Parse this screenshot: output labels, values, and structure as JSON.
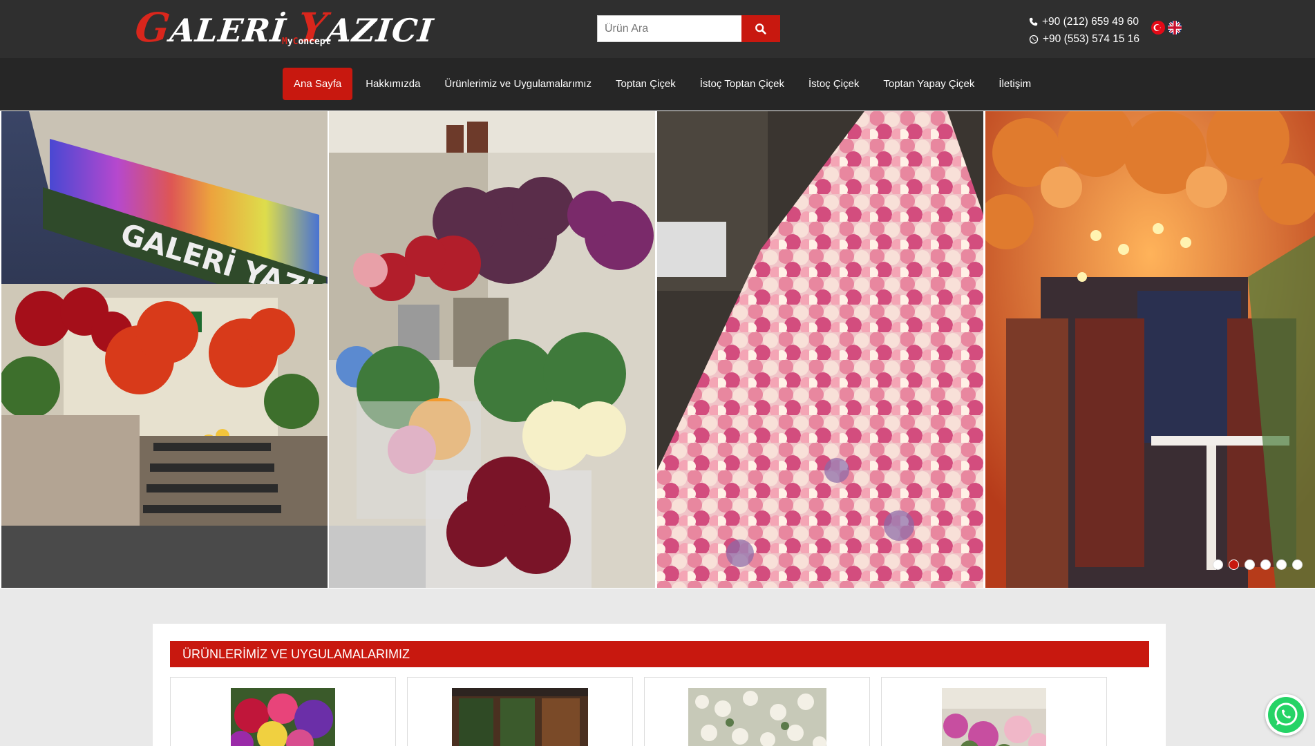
{
  "header": {
    "logo": {
      "first_initial": "G",
      "first_rest": "ALERİ",
      "second_initial": "Y",
      "second_rest": "AZICI",
      "sub_first_initial": "M",
      "sub_first_rest": "y",
      "sub_second_initial": "C",
      "sub_second_rest": "oncept"
    },
    "search": {
      "placeholder": "Ürün Ara",
      "button_icon": "search-icon"
    },
    "contacts": [
      {
        "icon": "phone-icon",
        "text": "+90 (212) 659 49 60"
      },
      {
        "icon": "whatsapp-icon",
        "text": "+90 (553) 574 15 16"
      }
    ],
    "languages": [
      {
        "icon": "turkey-flag-icon"
      },
      {
        "icon": "uk-flag-icon"
      }
    ]
  },
  "nav": {
    "items": [
      {
        "label": "Ana Sayfa",
        "active": true
      },
      {
        "label": "Hakkımızda"
      },
      {
        "label": "Ürünlerimiz ve Uygulamalarımız"
      },
      {
        "label": "Toptan Çiçek"
      },
      {
        "label": "İstoç Toptan Çiçek"
      },
      {
        "label": "İstoç Çiçek"
      },
      {
        "label": "Toptan Yapay Çiçek"
      },
      {
        "label": "İletişim"
      }
    ]
  },
  "slider": {
    "store_sign": "GALERİ YAZICI",
    "slide_count": 6,
    "active_index": 1
  },
  "products_section": {
    "title": "ÜRÜNLERİMİZ VE UYGULAMALARIMIZ",
    "items": [
      {
        "image": "flower-bouquet-thumb"
      },
      {
        "image": "green-wall-thumb"
      },
      {
        "image": "white-flowers-thumb"
      },
      {
        "image": "flower-shop-interior-thumb"
      }
    ]
  },
  "colors": {
    "brand_red": "#c8180f",
    "topbar": "#2f2f2f",
    "navbar": "#262626",
    "whatsapp_green": "#25d366"
  }
}
